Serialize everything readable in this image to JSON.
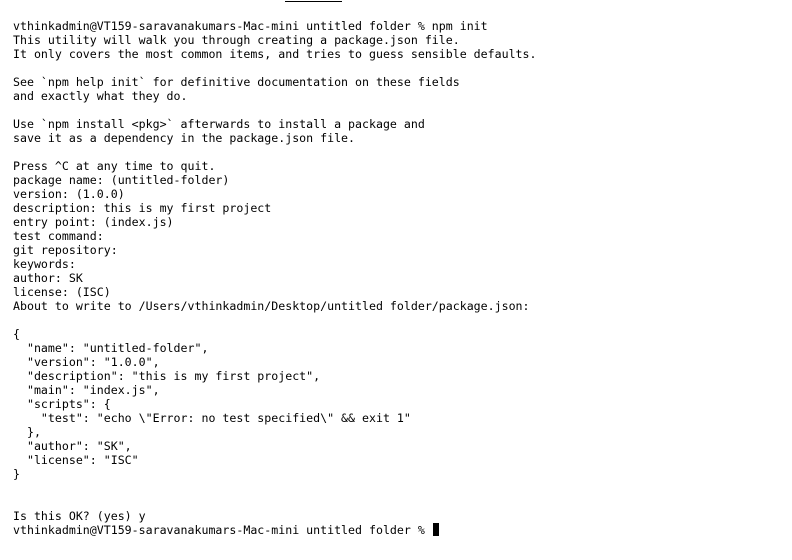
{
  "terminal": {
    "lines": [
      "vthinkadmin@VT159-saravanakumars-Mac-mini untitled folder % npm init",
      "This utility will walk you through creating a package.json file.",
      "It only covers the most common items, and tries to guess sensible defaults.",
      "",
      "See `npm help init` for definitive documentation on these fields",
      "and exactly what they do.",
      "",
      "Use `npm install <pkg>` afterwards to install a package and",
      "save it as a dependency in the package.json file.",
      "",
      "Press ^C at any time to quit.",
      "package name: (untitled-folder)",
      "version: (1.0.0)",
      "description: this is my first project",
      "entry point: (index.js)",
      "test command:",
      "git repository:",
      "keywords:",
      "author: SK",
      "license: (ISC)",
      "About to write to /Users/vthinkadmin/Desktop/untitled folder/package.json:",
      "",
      "{",
      "  \"name\": \"untitled-folder\",",
      "  \"version\": \"1.0.0\",",
      "  \"description\": \"this is my first project\",",
      "  \"main\": \"index.js\",",
      "  \"scripts\": {",
      "    \"test\": \"echo \\\"Error: no test specified\\\" && exit 1\"",
      "  },",
      "  \"author\": \"SK\",",
      "  \"license\": \"ISC\"",
      "}",
      "",
      "",
      "Is this OK? (yes) y"
    ],
    "prompt": "vthinkadmin@VT159-saravanakumars-Mac-mini untitled folder % ",
    "colors": {
      "background": "#ffffff",
      "text": "#000000",
      "cursor": "#000000"
    }
  }
}
